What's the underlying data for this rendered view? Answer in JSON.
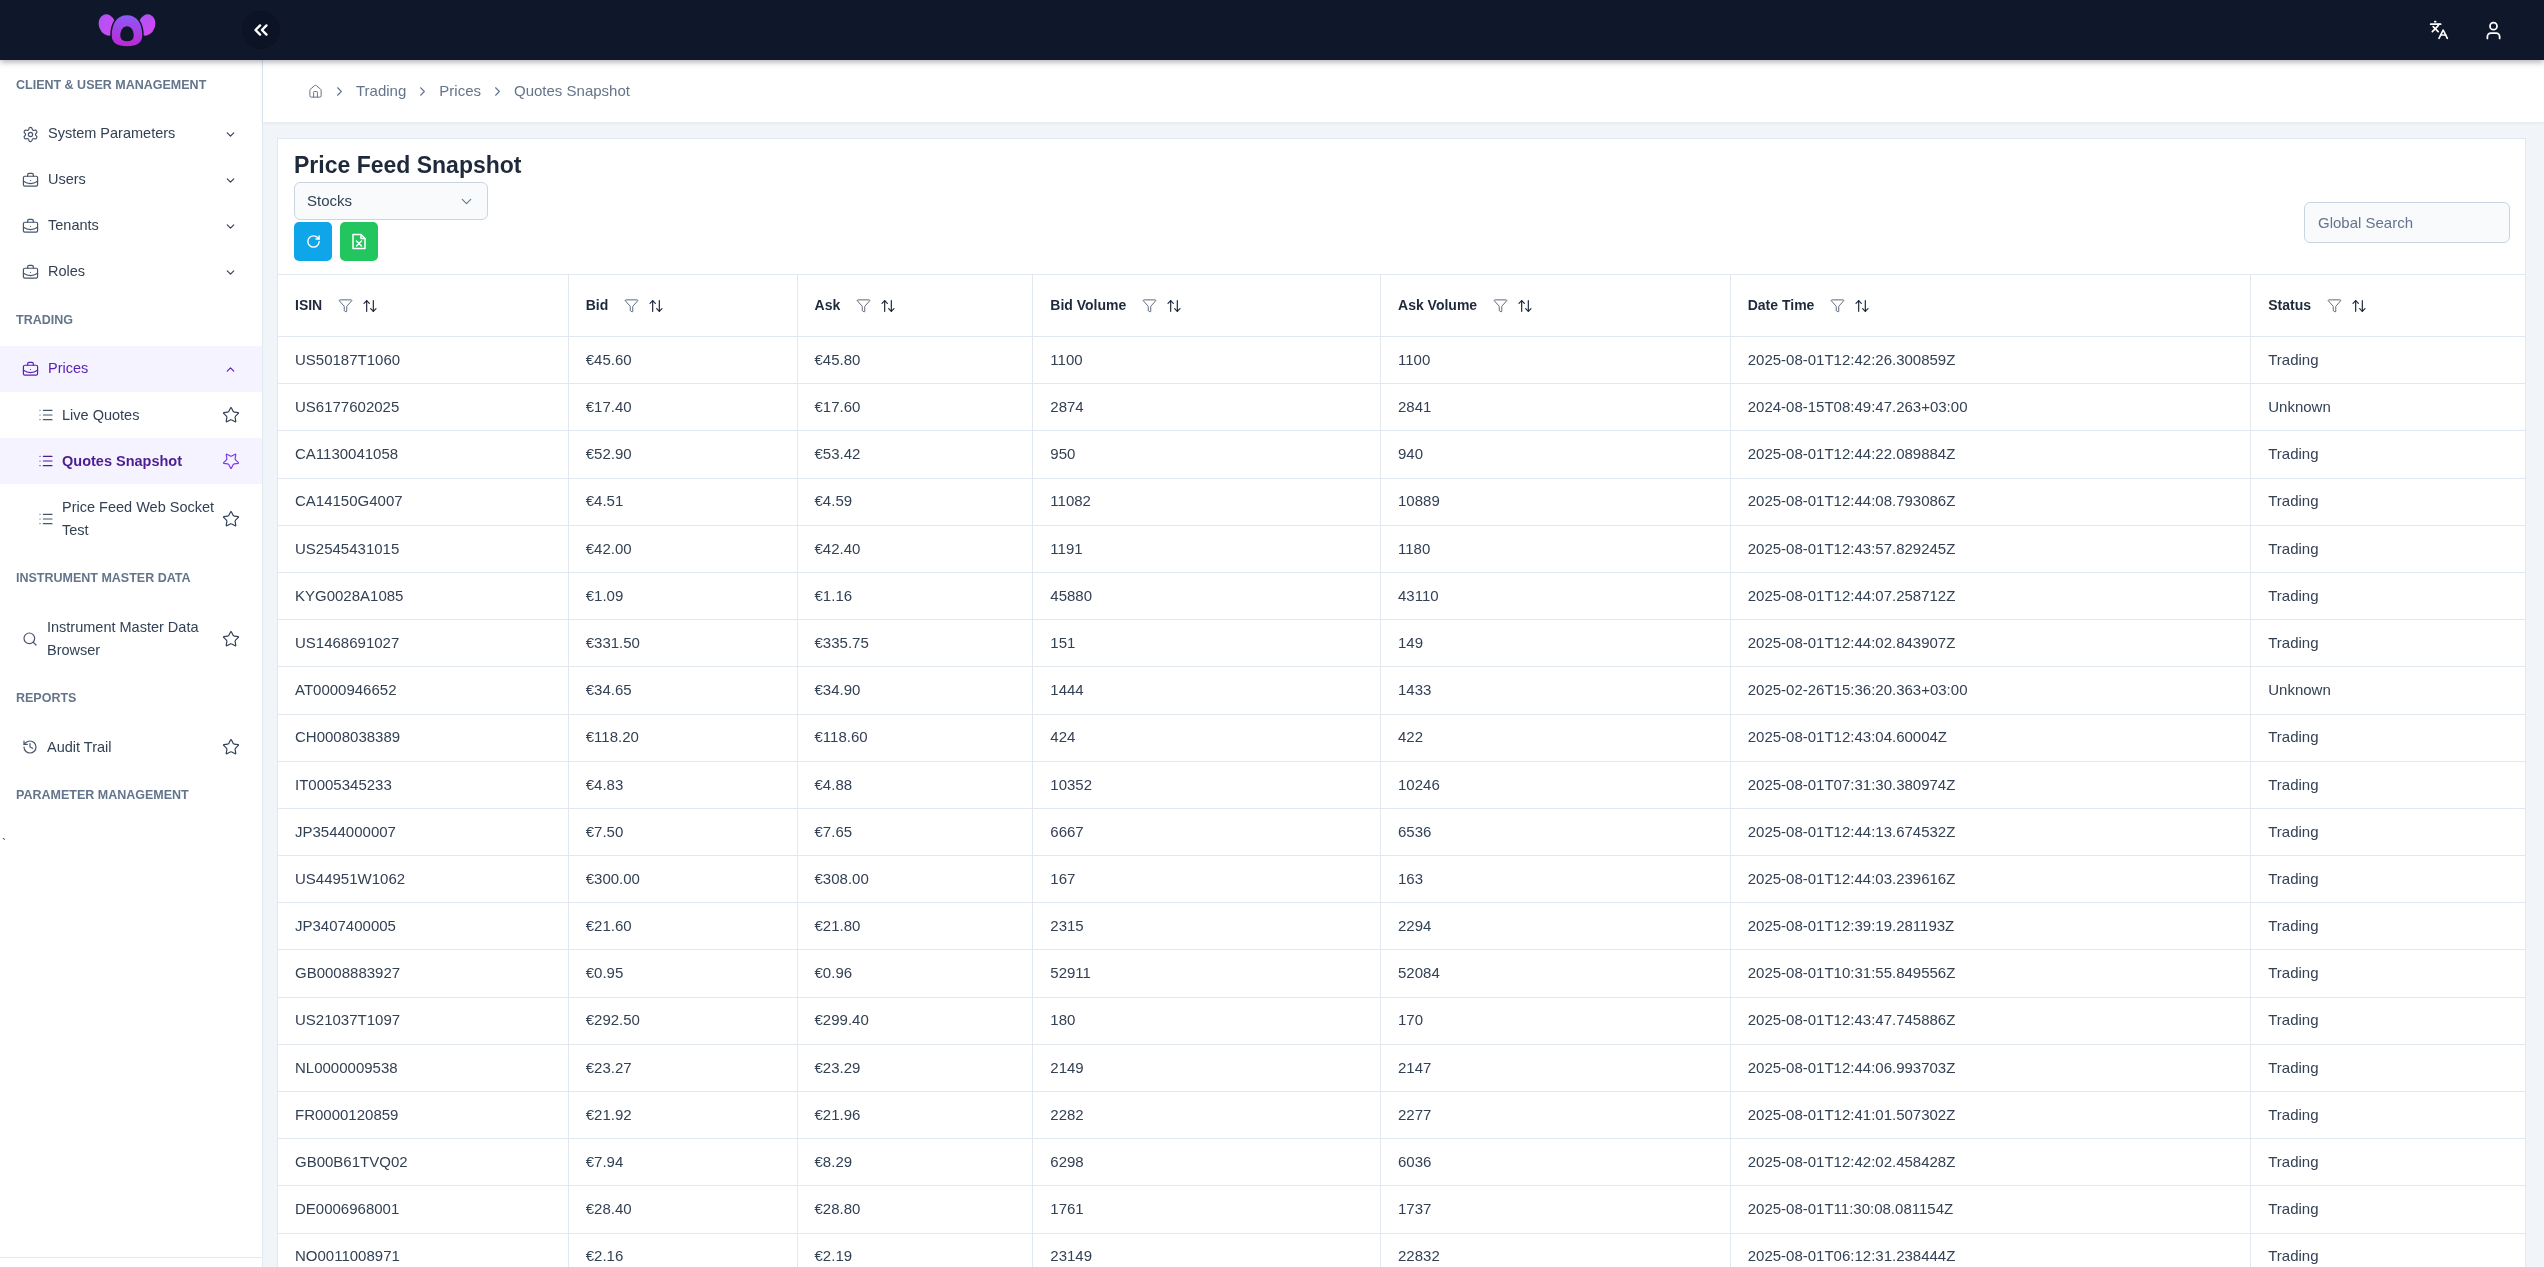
{
  "sidebar": {
    "sections": [
      {
        "title": "CLIENT & USER MANAGEMENT",
        "items": [
          {
            "label": "System Parameters",
            "kind": "group",
            "expanded": false
          },
          {
            "label": "Users",
            "kind": "group",
            "expanded": false
          },
          {
            "label": "Tenants",
            "kind": "group",
            "expanded": false
          },
          {
            "label": "Roles",
            "kind": "group",
            "expanded": false
          }
        ]
      },
      {
        "title": "TRADING",
        "items": [
          {
            "label": "Prices",
            "kind": "group",
            "expanded": true,
            "children": [
              {
                "label": "Live Quotes",
                "selected": false
              },
              {
                "label": "Quotes Snapshot",
                "selected": true
              },
              {
                "label": "Price Feed Web Socket Test",
                "selected": false
              }
            ]
          }
        ]
      },
      {
        "title": "INSTRUMENT MASTER DATA",
        "items": [
          {
            "label": "Instrument Master Data Browser",
            "kind": "page",
            "selected": false
          }
        ]
      },
      {
        "title": "REPORTS",
        "items": [
          {
            "label": "Audit Trail",
            "kind": "page",
            "selected": false
          }
        ]
      },
      {
        "title": "PARAMETER MANAGEMENT"
      }
    ],
    "trailing_mark": "`"
  },
  "breadcrumb": [
    "Trading",
    "Prices",
    "Quotes Snapshot"
  ],
  "page": {
    "title": "Price Feed Snapshot",
    "instrument_select": {
      "value": "Stocks"
    },
    "global_search": {
      "placeholder": "Global Search"
    }
  },
  "table": {
    "columns": [
      "ISIN",
      "Bid",
      "Ask",
      "Bid Volume",
      "Ask Volume",
      "Date Time",
      "Status"
    ],
    "rows": [
      [
        "US50187T1060",
        "€45.60",
        "€45.80",
        "1100",
        "1100",
        "2025-08-01T12:42:26.300859Z",
        "Trading"
      ],
      [
        "US6177602025",
        "€17.40",
        "€17.60",
        "2874",
        "2841",
        "2024-08-15T08:49:47.263+03:00",
        "Unknown"
      ],
      [
        "CA1130041058",
        "€52.90",
        "€53.42",
        "950",
        "940",
        "2025-08-01T12:44:22.089884Z",
        "Trading"
      ],
      [
        "CA14150G4007",
        "€4.51",
        "€4.59",
        "11082",
        "10889",
        "2025-08-01T12:44:08.793086Z",
        "Trading"
      ],
      [
        "US2545431015",
        "€42.00",
        "€42.40",
        "1191",
        "1180",
        "2025-08-01T12:43:57.829245Z",
        "Trading"
      ],
      [
        "KYG0028A1085",
        "€1.09",
        "€1.16",
        "45880",
        "43110",
        "2025-08-01T12:44:07.258712Z",
        "Trading"
      ],
      [
        "US1468691027",
        "€331.50",
        "€335.75",
        "151",
        "149",
        "2025-08-01T12:44:02.843907Z",
        "Trading"
      ],
      [
        "AT0000946652",
        "€34.65",
        "€34.90",
        "1444",
        "1433",
        "2025-02-26T15:36:20.363+03:00",
        "Unknown"
      ],
      [
        "CH0008038389",
        "€118.20",
        "€118.60",
        "424",
        "422",
        "2025-08-01T12:43:04.60004Z",
        "Trading"
      ],
      [
        "IT0005345233",
        "€4.83",
        "€4.88",
        "10352",
        "10246",
        "2025-08-01T07:31:30.380974Z",
        "Trading"
      ],
      [
        "JP3544000007",
        "€7.50",
        "€7.65",
        "6667",
        "6536",
        "2025-08-01T12:44:13.674532Z",
        "Trading"
      ],
      [
        "US44951W1062",
        "€300.00",
        "€308.00",
        "167",
        "163",
        "2025-08-01T12:44:03.239616Z",
        "Trading"
      ],
      [
        "JP3407400005",
        "€21.60",
        "€21.80",
        "2315",
        "2294",
        "2025-08-01T12:39:19.281193Z",
        "Trading"
      ],
      [
        "GB0008883927",
        "€0.95",
        "€0.96",
        "52911",
        "52084",
        "2025-08-01T10:31:55.849556Z",
        "Trading"
      ],
      [
        "US21037T1097",
        "€292.50",
        "€299.40",
        "180",
        "170",
        "2025-08-01T12:43:47.745886Z",
        "Trading"
      ],
      [
        "NL0000009538",
        "€23.27",
        "€23.29",
        "2149",
        "2147",
        "2025-08-01T12:44:06.993703Z",
        "Trading"
      ],
      [
        "FR0000120859",
        "€21.92",
        "€21.96",
        "2282",
        "2277",
        "2025-08-01T12:41:01.507302Z",
        "Trading"
      ],
      [
        "GB00B61TVQ02",
        "€7.94",
        "€8.29",
        "6298",
        "6036",
        "2025-08-01T12:42:02.458428Z",
        "Trading"
      ],
      [
        "DE0006968001",
        "€28.40",
        "€28.80",
        "1761",
        "1737",
        "2025-08-01T11:30:08.081154Z",
        "Trading"
      ],
      [
        "NO0011008971",
        "€2.16",
        "€2.19",
        "23149",
        "22832",
        "2025-08-01T06:12:31.238444Z",
        "Trading"
      ]
    ]
  }
}
